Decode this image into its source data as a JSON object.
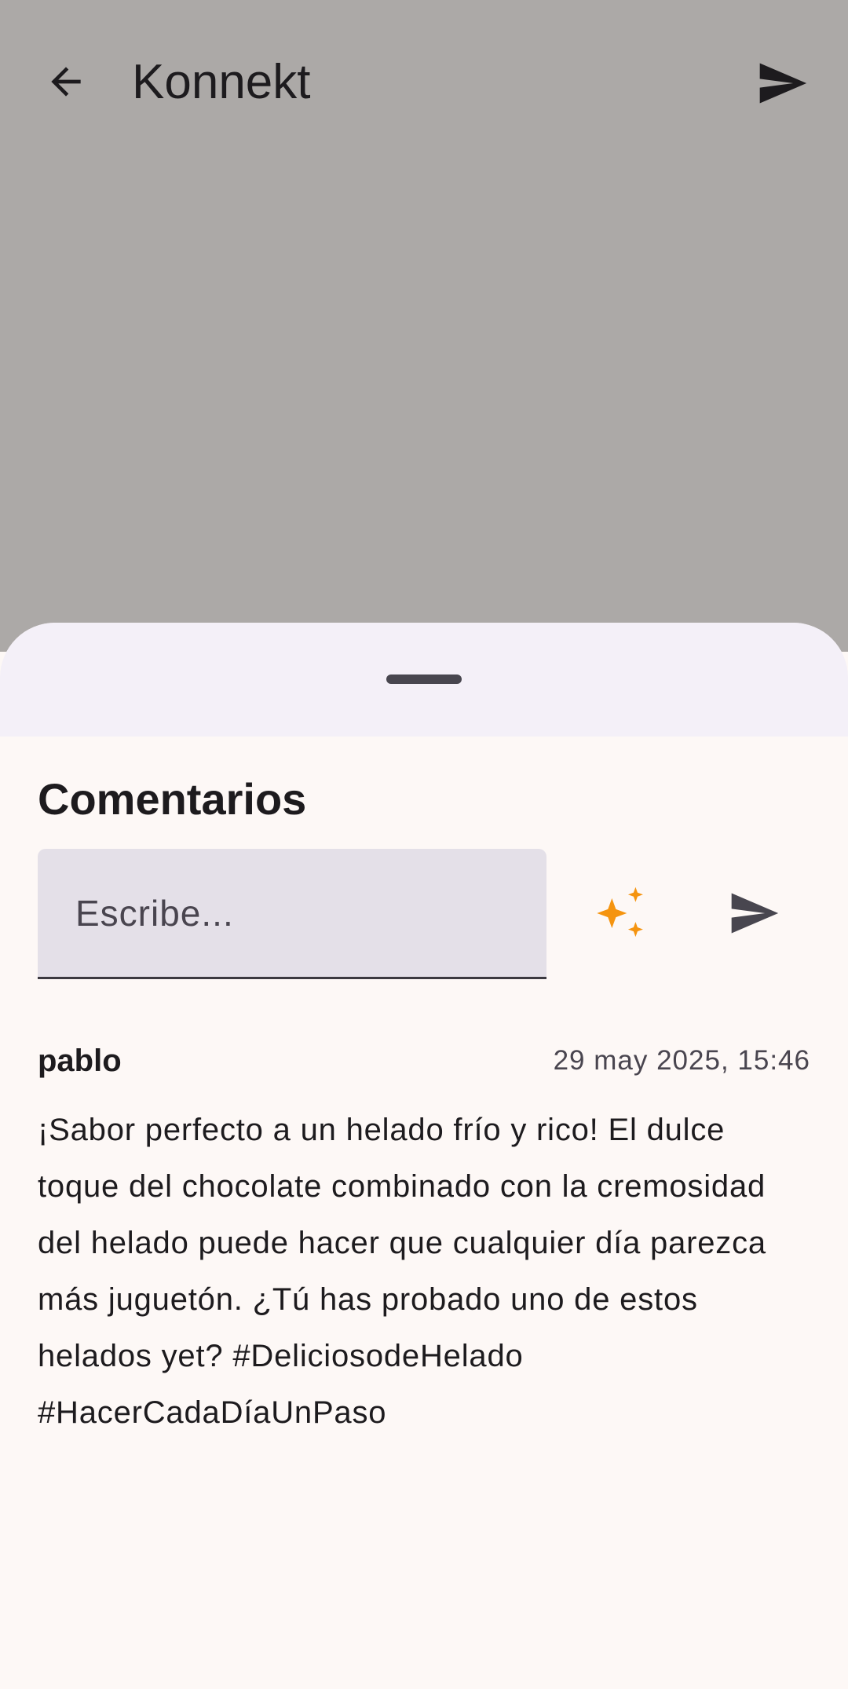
{
  "app": {
    "title": "Konnekt"
  },
  "sheet": {
    "title": "Comentarios",
    "input": {
      "placeholder": "Escribe...",
      "value": ""
    }
  },
  "comments": [
    {
      "author": "pablo",
      "date": "29 may 2025, 15:46",
      "text": "¡Sabor perfecto a un helado frío y rico! El dulce toque del chocolate combinado con la cremosidad del helado puede hacer que cualquier día parezca más juguetón. ¿Tú has probado uno de estos helados yet? #DeliciosodeHelado #HacerCadaDíaUnPaso"
    }
  ],
  "icons": {
    "back": "arrow-back-icon",
    "send": "send-icon",
    "ai": "sparkles-icon"
  },
  "colors": {
    "backdrop": "#aca9a7",
    "sheet_background": "#fdf8f6",
    "sheet_header": "#f4f0f8",
    "input_background": "#e4e0e8",
    "sparkle_accent": "#f5940f",
    "icon_dark": "#48464f"
  }
}
